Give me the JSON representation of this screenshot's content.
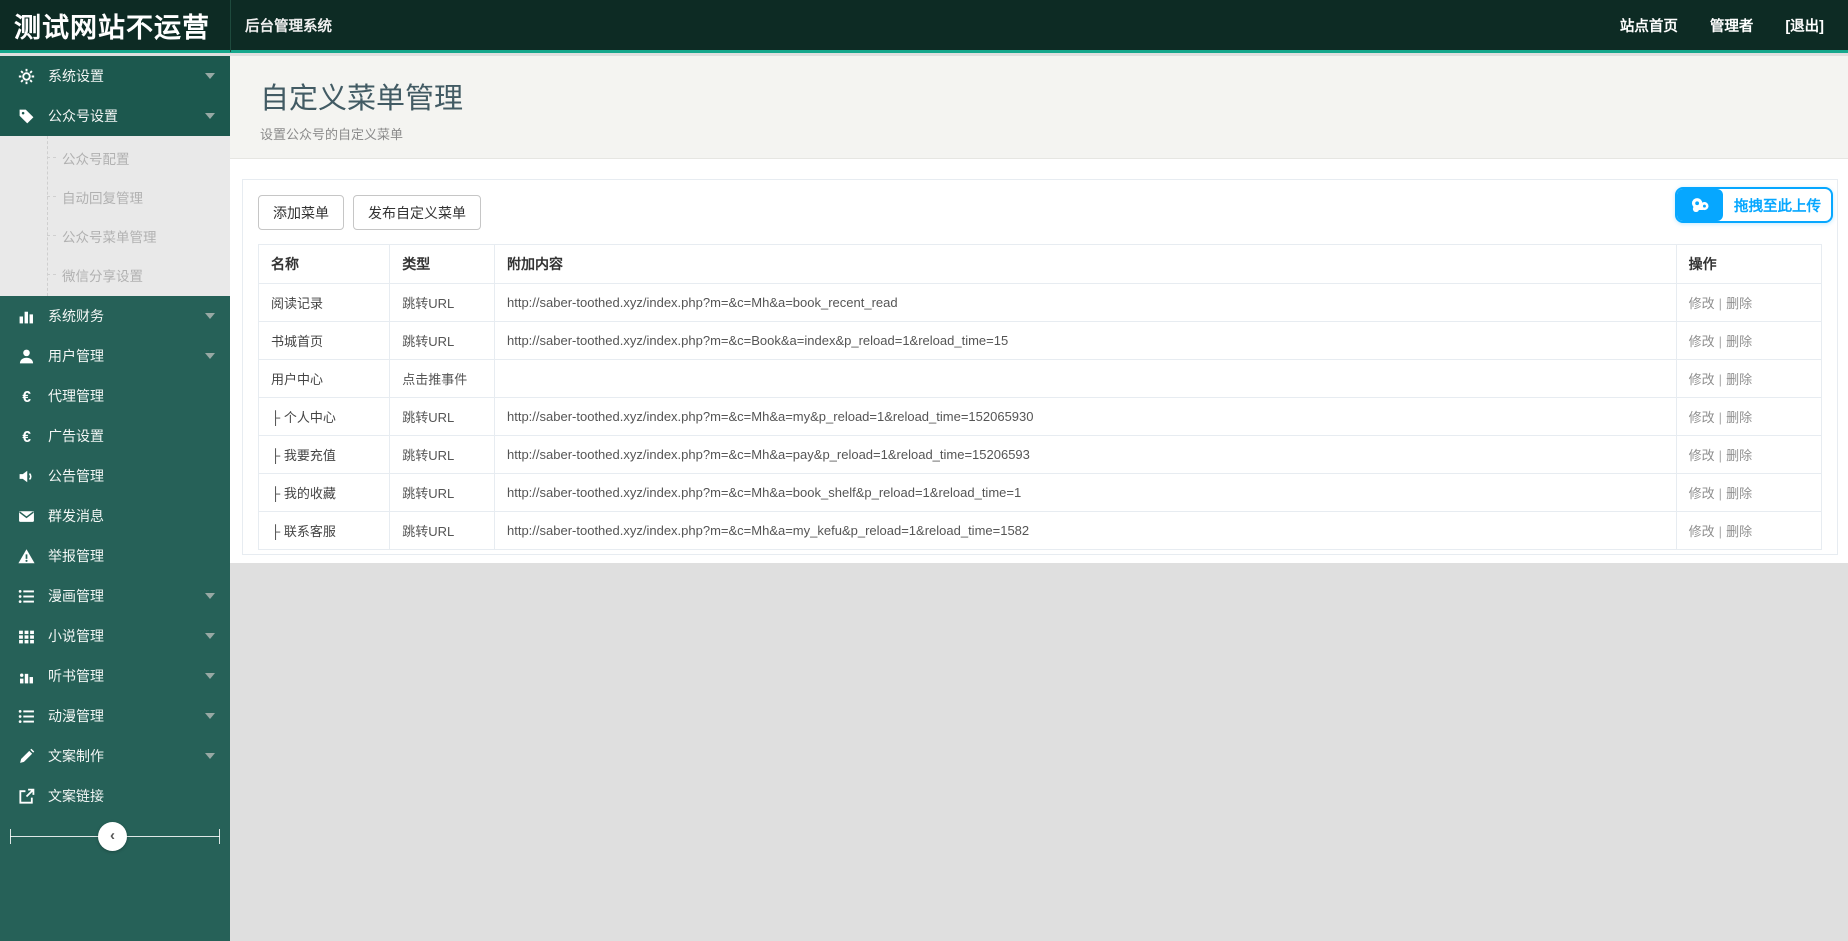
{
  "topbar": {
    "logo": "测试网站不运营",
    "system_title": "后台管理系统",
    "nav": {
      "site_home": "站点首页",
      "admin": "管理者",
      "logout": "[退出]"
    }
  },
  "sidebar": {
    "items": [
      {
        "label": "系统设置",
        "icon": "gear"
      },
      {
        "label": "公众号设置",
        "icon": "tags"
      },
      {
        "label": "系统财务",
        "icon": "bar-chart"
      },
      {
        "label": "用户管理",
        "icon": "user"
      },
      {
        "label": "代理管理",
        "icon": "euro"
      },
      {
        "label": "广告设置",
        "icon": "euro"
      },
      {
        "label": "公告管理",
        "icon": "megaphone"
      },
      {
        "label": "群发消息",
        "icon": "envelope"
      },
      {
        "label": "举报管理",
        "icon": "warning"
      },
      {
        "label": "漫画管理",
        "icon": "list"
      },
      {
        "label": "小说管理",
        "icon": "grid"
      },
      {
        "label": "听书管理",
        "icon": "audio-chart"
      },
      {
        "label": "动漫管理",
        "icon": "list"
      },
      {
        "label": "文案制作",
        "icon": "compose"
      },
      {
        "label": "文案链接",
        "icon": "external-link"
      }
    ],
    "wechat_submenu": [
      "公众号配置",
      "自动回复管理",
      "公众号菜单管理",
      "微信分享设置"
    ],
    "collapse_glyph": "‹"
  },
  "page": {
    "title": "自定义菜单管理",
    "subtitle": "设置公众号的自定义菜单"
  },
  "toolbar": {
    "add_menu_label": "添加菜单",
    "publish_menu_label": "发布自定义菜单"
  },
  "upload": {
    "label": "拖拽至此上传",
    "color": "#06a7ff"
  },
  "table": {
    "columns": [
      "名称",
      "类型",
      "附加内容",
      "操作"
    ],
    "edit_label": "修改",
    "separator": "|",
    "delete_label": "删除",
    "rows": [
      {
        "name": "阅读记录",
        "type": "跳转URL",
        "content": "http://saber-toothed.xyz/index.php?m=&c=Mh&a=book_recent_read"
      },
      {
        "name": "书城首页",
        "type": "跳转URL",
        "content": "http://saber-toothed.xyz/index.php?m=&c=Book&a=index&p_reload=1&reload_time=15"
      },
      {
        "name": "用户中心",
        "type": "点击推事件",
        "content": ""
      },
      {
        "name": "├ 个人中心",
        "type": "跳转URL",
        "content": "http://saber-toothed.xyz/index.php?m=&c=Mh&a=my&p_reload=1&reload_time=152065930"
      },
      {
        "name": "├ 我要充值",
        "type": "跳转URL",
        "content": "http://saber-toothed.xyz/index.php?m=&c=Mh&a=pay&p_reload=1&reload_time=15206593"
      },
      {
        "name": "├ 我的收藏",
        "type": "跳转URL",
        "content": "http://saber-toothed.xyz/index.php?m=&c=Mh&a=book_shelf&p_reload=1&reload_time=1"
      },
      {
        "name": "├ 联系客服",
        "type": "跳转URL",
        "content": "http://saber-toothed.xyz/index.php?m=&c=Mh&a=my_kefu&p_reload=1&reload_time=1582"
      }
    ]
  },
  "colors": {
    "topbar_bg": "#0d2b24",
    "accent_teal": "#15a78c",
    "sidebar_bg": "#266158",
    "sidebar_active_bg": "#1c584e",
    "upload_blue": "#06a7ff"
  }
}
